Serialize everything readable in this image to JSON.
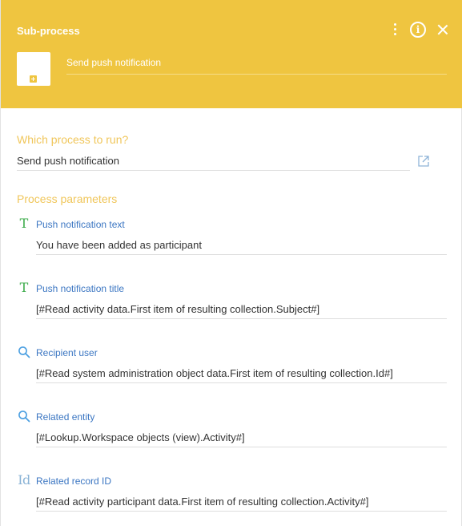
{
  "colors": {
    "header_bg": "#efc540",
    "caption": "#f0c65a",
    "label": "#3b76c2",
    "text_icon": "#3bab4a",
    "search_icon": "#4b9fe1"
  },
  "header": {
    "title": "Sub-process",
    "element_name": "Send push notification",
    "icons": [
      "kebab-menu-icon",
      "info-icon",
      "close-icon",
      "subprocess-element-icon"
    ]
  },
  "process_section": {
    "caption": "Which process to run?",
    "value": "Send push notification",
    "link_icon": "open-external-icon"
  },
  "parameters_section": {
    "caption": "Process parameters",
    "items": [
      {
        "icon": "text-icon",
        "label": "Push notification text",
        "value": "You have been added as participant"
      },
      {
        "icon": "text-icon",
        "label": "Push notification title",
        "value": "[#Read activity data.First item of resulting collection.Subject#]"
      },
      {
        "icon": "search-icon",
        "label": "Recipient user",
        "value": "[#Read system administration object data.First item of resulting collection.Id#]"
      },
      {
        "icon": "search-icon",
        "label": "Related entity",
        "value": "[#Lookup.Workspace objects (view).Activity#]"
      },
      {
        "icon": "id-icon",
        "label": "Related record ID",
        "value": "[#Read activity participant data.First item of resulting collection.Activity#]"
      }
    ]
  }
}
